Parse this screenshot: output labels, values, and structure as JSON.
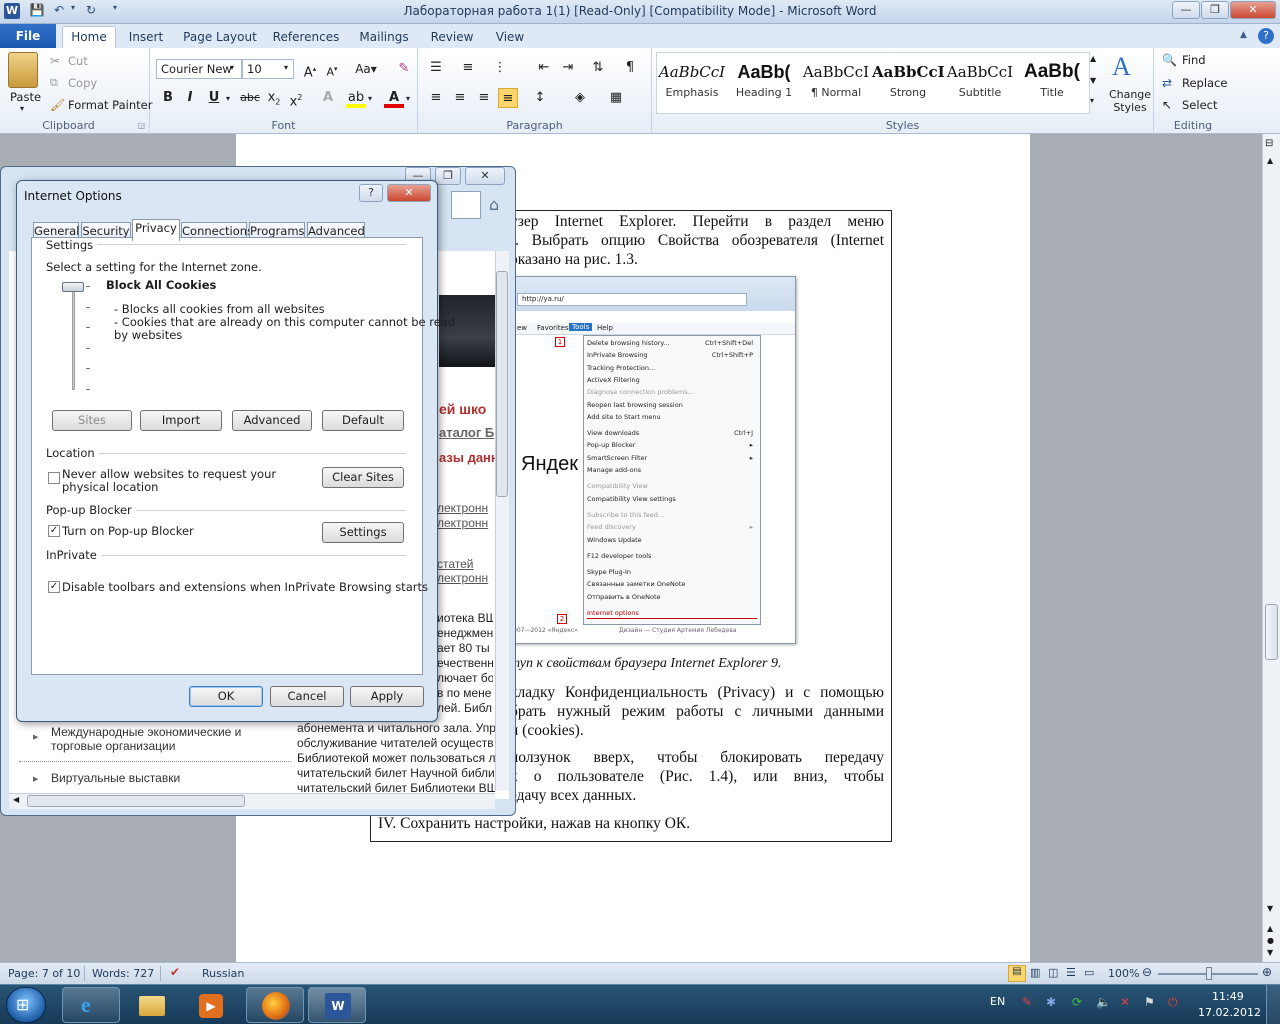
{
  "window": {
    "title": "Лабораторная работа 1(1) [Read-Only] [Compatibility Mode]  -  Microsoft Word",
    "app_icon": "W"
  },
  "ribbon_tabs": [
    "File",
    "Home",
    "Insert",
    "Page Layout",
    "References",
    "Mailings",
    "Review",
    "View"
  ],
  "clipboard": {
    "paste": "Paste",
    "cut": "Cut",
    "copy": "Copy",
    "format_painter": "Format Painter",
    "label": "Clipboard"
  },
  "font": {
    "name": "Courier New",
    "size": "10",
    "label": "Font"
  },
  "paragraph": {
    "label": "Paragraph"
  },
  "styles": {
    "items": [
      {
        "preview": "AaBbCcI",
        "name": "Emphasis"
      },
      {
        "preview": "AaBb(",
        "name": "Heading 1"
      },
      {
        "preview": "AaBbCcI",
        "name": "¶ Normal"
      },
      {
        "preview": "AaBbCcI",
        "name": "Strong"
      },
      {
        "preview": "AaBbCcI",
        "name": "Subtitle"
      },
      {
        "preview": "AaBb(",
        "name": "Title"
      }
    ],
    "change_styles": "Change Styles",
    "label": "Styles"
  },
  "editing": {
    "find": "Find",
    "replace": "Replace",
    "select": "Select",
    "label": "Editing"
  },
  "document": {
    "lines": [
      "узер Internet Explorer. Перейти в раздел меню",
      "). Выбрать опцию Свойства обозревателя (Internet",
      "оказано на рис. 1.3."
    ],
    "caption": "туп к свойствам браузера Internet Explorer 9.",
    "para2": [
      "кладку Конфиденциальность (Privacy) и с помощью",
      "брать нужный режим работы с личными данными",
      "и (cookies)."
    ],
    "para3": [
      "ползунок вверх, чтобы блокировать передачу",
      "х о пользователе (Рис. 1.4), или вниз, чтобы",
      "едачу всех данных."
    ],
    "step4": "IV.   Сохранить настройки,  нажав на  кнопку ОК."
  },
  "screenshot_menu": {
    "address": "http://ya.ru/",
    "menubar": [
      "ew",
      "Favorites",
      "Tools",
      "Help"
    ],
    "items": [
      {
        "t": "Delete browsing history...",
        "k": "Ctrl+Shift+Del"
      },
      {
        "t": "InPrivate Browsing",
        "k": "Ctrl+Shift+P"
      },
      {
        "t": "Tracking Protection...",
        "k": ""
      },
      {
        "t": "ActiveX Filtering",
        "k": ""
      },
      {
        "t": "Diagnose connection problems...",
        "k": ""
      },
      {
        "t": "Reopen last browsing session",
        "k": ""
      },
      {
        "t": "Add site to Start menu",
        "k": ""
      },
      {
        "t": "View downloads",
        "k": "Ctrl+J"
      },
      {
        "t": "Pop-up Blocker",
        "k": "▸"
      },
      {
        "t": "SmartScreen Filter",
        "k": "▸"
      },
      {
        "t": "Manage add-ons",
        "k": ""
      },
      {
        "t": "Compatibility View",
        "k": ""
      },
      {
        "t": "Compatibility View settings",
        "k": ""
      },
      {
        "t": "Subscribe to this feed...",
        "k": ""
      },
      {
        "t": "Feed discovery",
        "k": "▸"
      },
      {
        "t": "Windows Update",
        "k": ""
      },
      {
        "t": "F12 developer tools",
        "k": ""
      },
      {
        "t": "Skype Plug-In",
        "k": ""
      },
      {
        "t": "Связанные заметки OneNote",
        "k": ""
      },
      {
        "t": "Отправить в OneNote",
        "k": ""
      },
      {
        "t": "Internet options",
        "k": ""
      }
    ],
    "marker1": "1",
    "marker2": "2",
    "yandex": "Яндек",
    "footer": "007—2012 «Яндекс»",
    "footer2": "Дизайн — Студия Артемия Лебедева"
  },
  "ie_back": {
    "red1": "ей шко",
    "link1": "аталог Б",
    "red2": "азы данн",
    "links": [
      "лектронн",
      "лектронн",
      "статей",
      "лектронн"
    ],
    "body": [
      "иотека ВШ",
      "енеджмен",
      "ает 80 ты",
      "ечественн",
      "лючает бо",
      "в по мене",
      "лей. Библ"
    ],
    "bottom": [
      "абонемента и читального зала. Упр",
      "обслуживание читателей осуществ",
      "Библиотекой может пользоваться л",
      "читательский билет Научной библи",
      "читательский билет Библиотеки ВШ"
    ],
    "nav1a": "Международные экономические и",
    "nav1b": "торговые организации",
    "nav2": "Виртуальные выставки"
  },
  "dialog": {
    "title": "Internet Options",
    "tabs": [
      "General",
      "Security",
      "Privacy",
      "Connections",
      "Programs",
      "Advanced"
    ],
    "active_tab": "Privacy",
    "settings_label": "Settings",
    "zone_prompt": "Select a setting for the Internet zone.",
    "level_title": "Block All Cookies",
    "level_desc1": "- Blocks all cookies from all websites",
    "level_desc2": "- Cookies that are already on this computer cannot be read",
    "level_desc3": "by websites",
    "slider_level": 1.0,
    "buttons_row": [
      "Sites",
      "Import",
      "Advanced",
      "Default"
    ],
    "location_label": "Location",
    "location_check": "Never allow websites to request your",
    "location_check2": "physical location",
    "location_checked": false,
    "clear_sites": "Clear Sites",
    "popup_label": "Pop-up Blocker",
    "popup_check": "Turn on Pop-up Blocker",
    "popup_checked": true,
    "popup_settings": "Settings",
    "inprivate_label": "InPrivate",
    "inprivate_check": "Disable toolbars and extensions when InPrivate Browsing starts",
    "inprivate_checked": true,
    "ok": "OK",
    "cancel": "Cancel",
    "apply": "Apply",
    "help": "?",
    "close": "✕"
  },
  "status": {
    "page": "Page: 7 of 10",
    "words": "Words: 727",
    "lang": "Russian",
    "zoom": "100%"
  },
  "tray": {
    "lang": "EN",
    "time": "11:49",
    "date": "17.02.2012"
  }
}
